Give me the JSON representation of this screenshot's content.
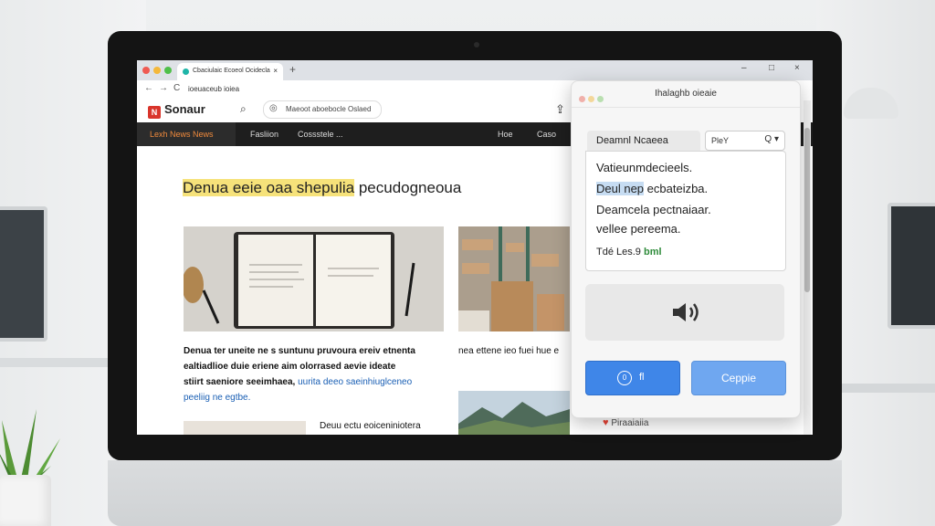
{
  "browser": {
    "tab_title": "Cbaciulaic Ecoeol Ocidecla",
    "tab_close": "×",
    "new_tab": "+",
    "address": "ioeuaceub ioiea",
    "nav_back": "←",
    "nav_forward": "→",
    "nav_reload": "C",
    "win_min": "–",
    "win_max": "□",
    "win_close": "×"
  },
  "site": {
    "logo_text": "Sonaur",
    "logo_mark": "N",
    "search_placeholder": "Maeoot aboebocle Oslaed",
    "nav_left": [
      "Lexh News News",
      "Fasliion",
      "Cossstele ..."
    ],
    "nav_right": [
      "Hoe",
      "Caso"
    ]
  },
  "article": {
    "headline_highlight": "Denua eeie oaa shepulia",
    "headline_rest": " pecudogneoua",
    "caption1_lines": [
      "Denua ter uneite ne s suntunu pruvoura ereiv etnenta",
      "ealtiadlioe duie eriene aim olorrased aevie ideate"
    ],
    "caption1_bold3": "stiirt saeniore seeimhaea,",
    "caption1_link3": " uurita deeo saeinhiuglceneo",
    "caption1_link4": "peeliig ne egtbe.",
    "caption2": "nea ettene ieo fuei hue e",
    "caption3": "Deuu ectu eoiceniniotera"
  },
  "popup": {
    "title": "Ihalaghb oieaie",
    "voice_label": "Deamnl Ncaeea",
    "play_label": "PleY",
    "play_search_icon": "Q ▾",
    "text_line1": "Vatieunmdecieels.",
    "text_line2_sel": "Deul nep",
    "text_line2_rest": " ecbateizba.",
    "text_line3": "Deamcela pectnaiaar.",
    "text_line4": "vellee pereema.",
    "meta_prefix": "Tdé Les.9",
    "meta_value": "bml",
    "button1_icon": "0",
    "button1_label": "fl",
    "button2_label": "Ceppie"
  },
  "below_popup": {
    "icon": "♥",
    "text": "Piraaiaiia"
  }
}
